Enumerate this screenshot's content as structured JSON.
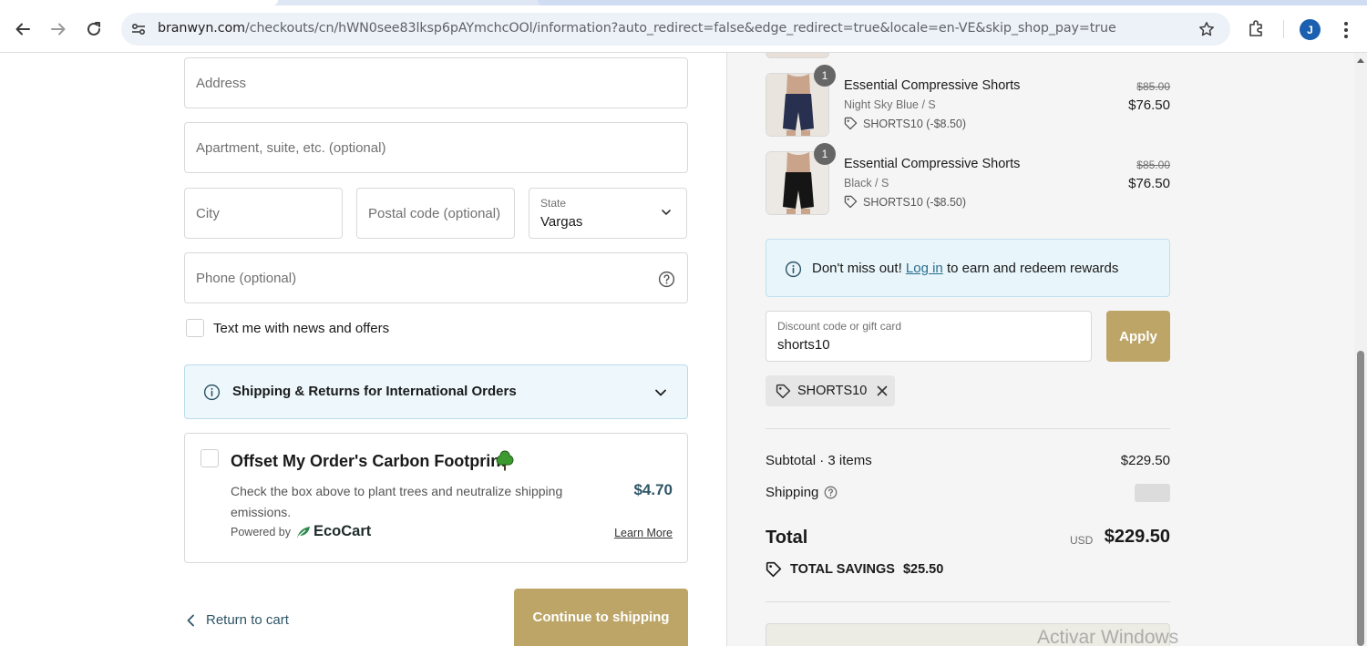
{
  "browser": {
    "url_host": "branwyn.com",
    "url_rest": "/checkouts/cn/hWN0see83lksp6pAYmchcOOl/information?auto_redirect=false&edge_redirect=true&locale=en-VE&skip_shop_pay=true",
    "profile_initial": "J"
  },
  "form": {
    "address_placeholder": "Address",
    "apartment_placeholder": "Apartment, suite, etc. (optional)",
    "city_placeholder": "City",
    "postal_placeholder": "Postal code (optional)",
    "state_label": "State",
    "state_value": "Vargas",
    "phone_placeholder": "Phone (optional)",
    "text_me_label": "Text me with news and offers"
  },
  "shipping_accordion": {
    "title": "Shipping & Returns for International Orders"
  },
  "ecocart": {
    "title": "Offset My Order's Carbon Footprint",
    "description": "Check the box above to plant trees and neutralize shipping emissions.",
    "price": "$4.70",
    "powered_by": "Powered by",
    "brand": "EcoCart",
    "learn_more": "Learn More",
    "tree_color": "#3c9a2e"
  },
  "footer_actions": {
    "return_label": "Return to cart",
    "continue_label": "Continue to shipping"
  },
  "cart": {
    "items": [
      {
        "name": "Essential Compressive Shorts",
        "variant": "Night Sky Blue / S",
        "quantity": "1",
        "discount": "SHORTS10 (-$8.50)",
        "compare_price": "$85.00",
        "price": "$76.50",
        "swatch": "#27304f"
      },
      {
        "name": "Essential Compressive Shorts",
        "variant": "Black / S",
        "quantity": "1",
        "discount": "SHORTS10 (-$8.50)",
        "compare_price": "$85.00",
        "price": "$76.50",
        "swatch": "#151515"
      }
    ]
  },
  "rewards": {
    "prefix": "Don't miss out!",
    "login": "Log in",
    "suffix": "to earn and redeem rewards"
  },
  "discount": {
    "label": "Discount code or gift card",
    "value": "shorts10",
    "apply_label": "Apply",
    "applied_code": "SHORTS10"
  },
  "summary": {
    "subtotal_label": "Subtotal · 3 items",
    "subtotal_value": "$229.50",
    "shipping_label": "Shipping",
    "total_label": "Total",
    "currency": "USD",
    "total_value": "$229.50",
    "savings_label": "TOTAL SAVINGS",
    "savings_value": "$25.50"
  },
  "watermark": "Activar Windows",
  "colors": {
    "accent_gold": "#bca567",
    "link_teal": "#2f5566"
  }
}
